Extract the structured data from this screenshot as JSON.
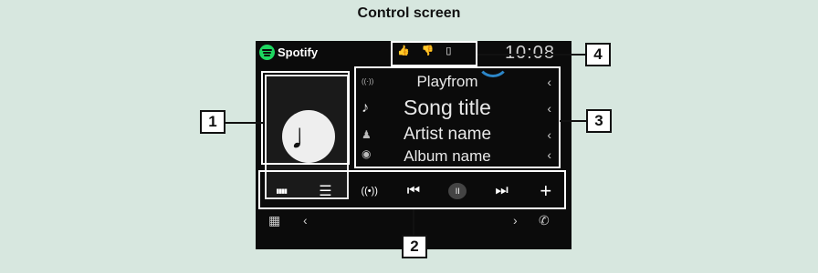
{
  "heading": "Control screen",
  "app": {
    "name": "Spotify",
    "clock": "10:08"
  },
  "artwork": {
    "icon": "music-note-icon",
    "glyph": "♩"
  },
  "rows": [
    {
      "icon": "broadcast-icon",
      "glyph": "((·))",
      "text": "Playfrom"
    },
    {
      "icon": "music-note-icon",
      "glyph": "♪",
      "text": "Song title"
    },
    {
      "icon": "person-icon",
      "glyph": "♟",
      "text": "Artist name"
    },
    {
      "icon": "disc-icon",
      "glyph": "◉",
      "text": "Album name"
    }
  ],
  "row_chevron": "‹",
  "controls": [
    {
      "name": "equalizer-icon",
      "glyph": "▮▮▮▮"
    },
    {
      "name": "list-icon",
      "glyph": "☰"
    },
    {
      "name": "radio-icon",
      "glyph": "((•))"
    },
    {
      "name": "previous-icon",
      "glyph": "⏮"
    },
    {
      "name": "pause-icon",
      "glyph": "II"
    },
    {
      "name": "next-icon",
      "glyph": "⏭"
    },
    {
      "name": "add-icon",
      "glyph": "+"
    }
  ],
  "bottom": {
    "menu_glyph": "▦",
    "left_glyph": "‹",
    "right_glyph": "›",
    "phone_glyph": "✆"
  },
  "rating": {
    "up": "👍",
    "down": "👎",
    "extra": "▯"
  },
  "callouts": [
    "1",
    "2",
    "3",
    "4"
  ],
  "colors": {
    "background": "#d7e7df",
    "screen": "#0b0b0b",
    "spotify_green": "#1ed760",
    "accent_blue": "#2c86c8"
  }
}
